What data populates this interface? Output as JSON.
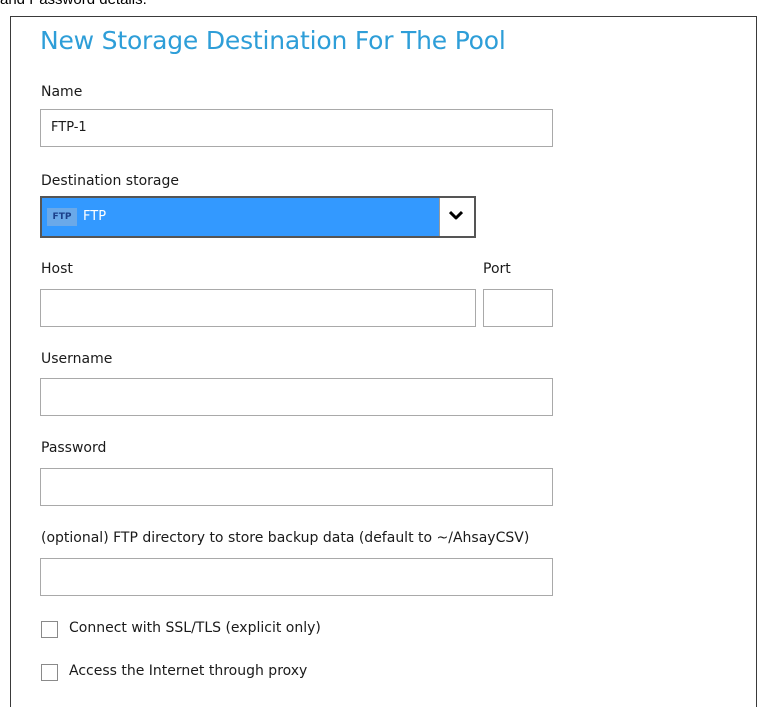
{
  "top_text": "and Password details.",
  "dialog": {
    "title": "New Storage Destination For The Pool"
  },
  "fields": {
    "name_label": "Name",
    "name_value": "FTP-1",
    "destination_label": "Destination storage",
    "destination_icon_text": "FTP",
    "destination_value": "FTP",
    "host_label": "Host",
    "host_value": "",
    "port_label": "Port",
    "port_value": "",
    "username_label": "Username",
    "username_value": "",
    "password_label": "Password",
    "password_value": "",
    "directory_label": "(optional) FTP directory to store backup data (default to ~/AhsayCSV)",
    "directory_value": ""
  },
  "options": {
    "ssl_label": "Connect with SSL/TLS (explicit only)",
    "ssl_checked": false,
    "proxy_label": "Access the Internet through proxy",
    "proxy_checked": false
  },
  "colors": {
    "title": "#2e9ed8",
    "select_highlight": "#3399ff"
  },
  "icons": {
    "dropdown": "chevron-down-icon",
    "storage_type": "ftp-icon"
  }
}
